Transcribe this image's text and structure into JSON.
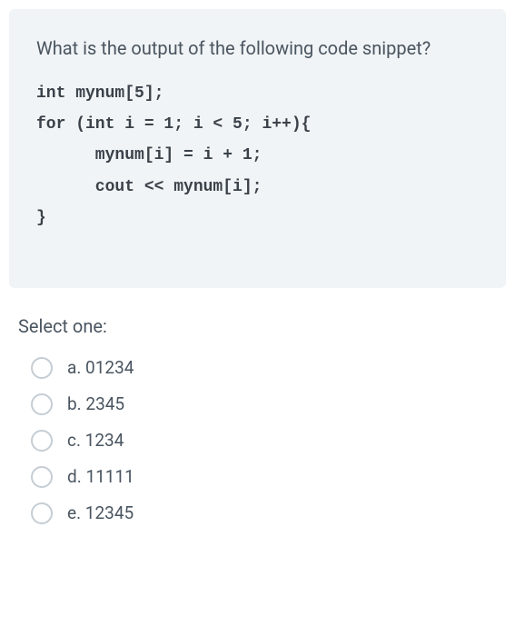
{
  "question": {
    "prompt": "What is the output of the following code snippet?",
    "code_lines": [
      "int mynum[5];",
      "for (int i = 1; i < 5; i++){",
      "      mynum[i] = i + 1;",
      "      cout << mynum[i];",
      "}"
    ]
  },
  "answers": {
    "select_label": "Select one:",
    "options": [
      {
        "id": "a",
        "label": "a. 01234"
      },
      {
        "id": "b",
        "label": "b. 2345"
      },
      {
        "id": "c",
        "label": "c. 1234"
      },
      {
        "id": "d",
        "label": "d. 11111"
      },
      {
        "id": "e",
        "label": "e. 12345"
      }
    ]
  }
}
